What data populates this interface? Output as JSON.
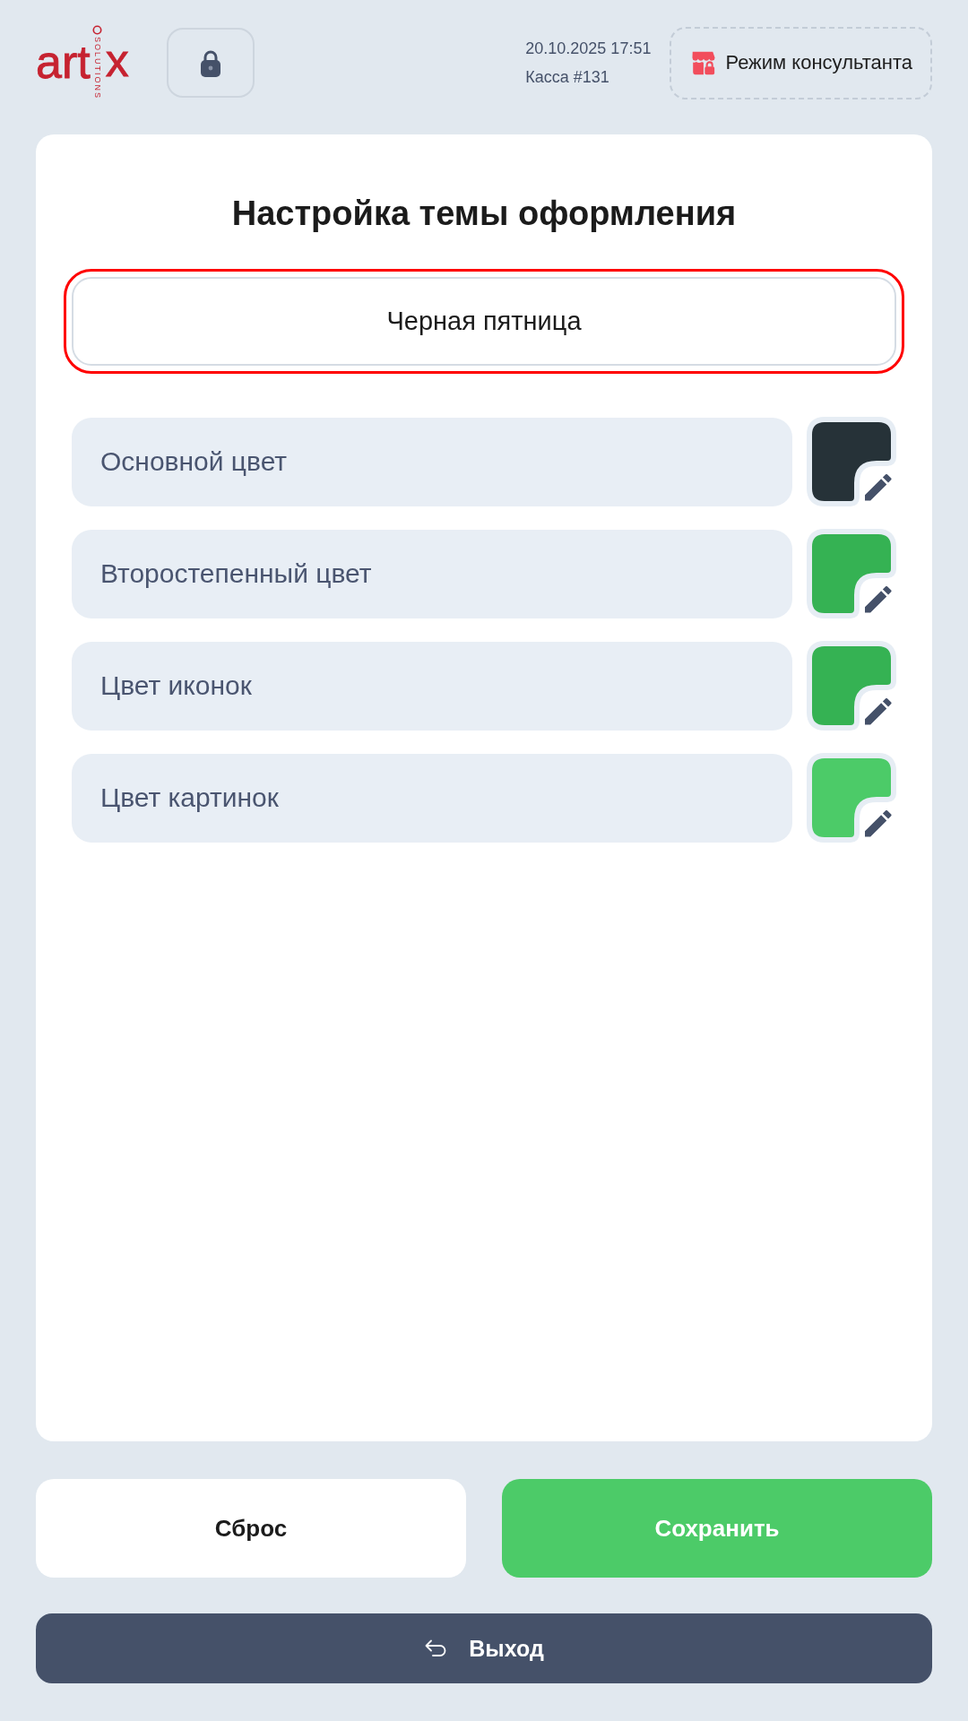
{
  "header": {
    "logo": {
      "wordmark_left": "art",
      "tagline": "SOLUTIONS",
      "wordmark_right": "x"
    },
    "datetime": "20.10.2025 17:51",
    "register": "Касса #131",
    "consultant_button": {
      "label": "Режим консультанта"
    }
  },
  "panel": {
    "title": "Настройка темы оформления",
    "theme_field": {
      "value": "Черная пятница",
      "highlighted": true
    },
    "colors": [
      {
        "label": "Основной цвет",
        "color": "#263238"
      },
      {
        "label": "Второстепенный цвет",
        "color": "#35b253"
      },
      {
        "label": "Цвет иконок",
        "color": "#35b253"
      },
      {
        "label": "Цвет картинок",
        "color": "#4ccb68"
      }
    ]
  },
  "actions": [
    {
      "label": "Сброс",
      "kind": "secondary"
    },
    {
      "label": "Сохранить",
      "kind": "primary"
    }
  ],
  "exit_button": {
    "label": "Выход"
  }
}
